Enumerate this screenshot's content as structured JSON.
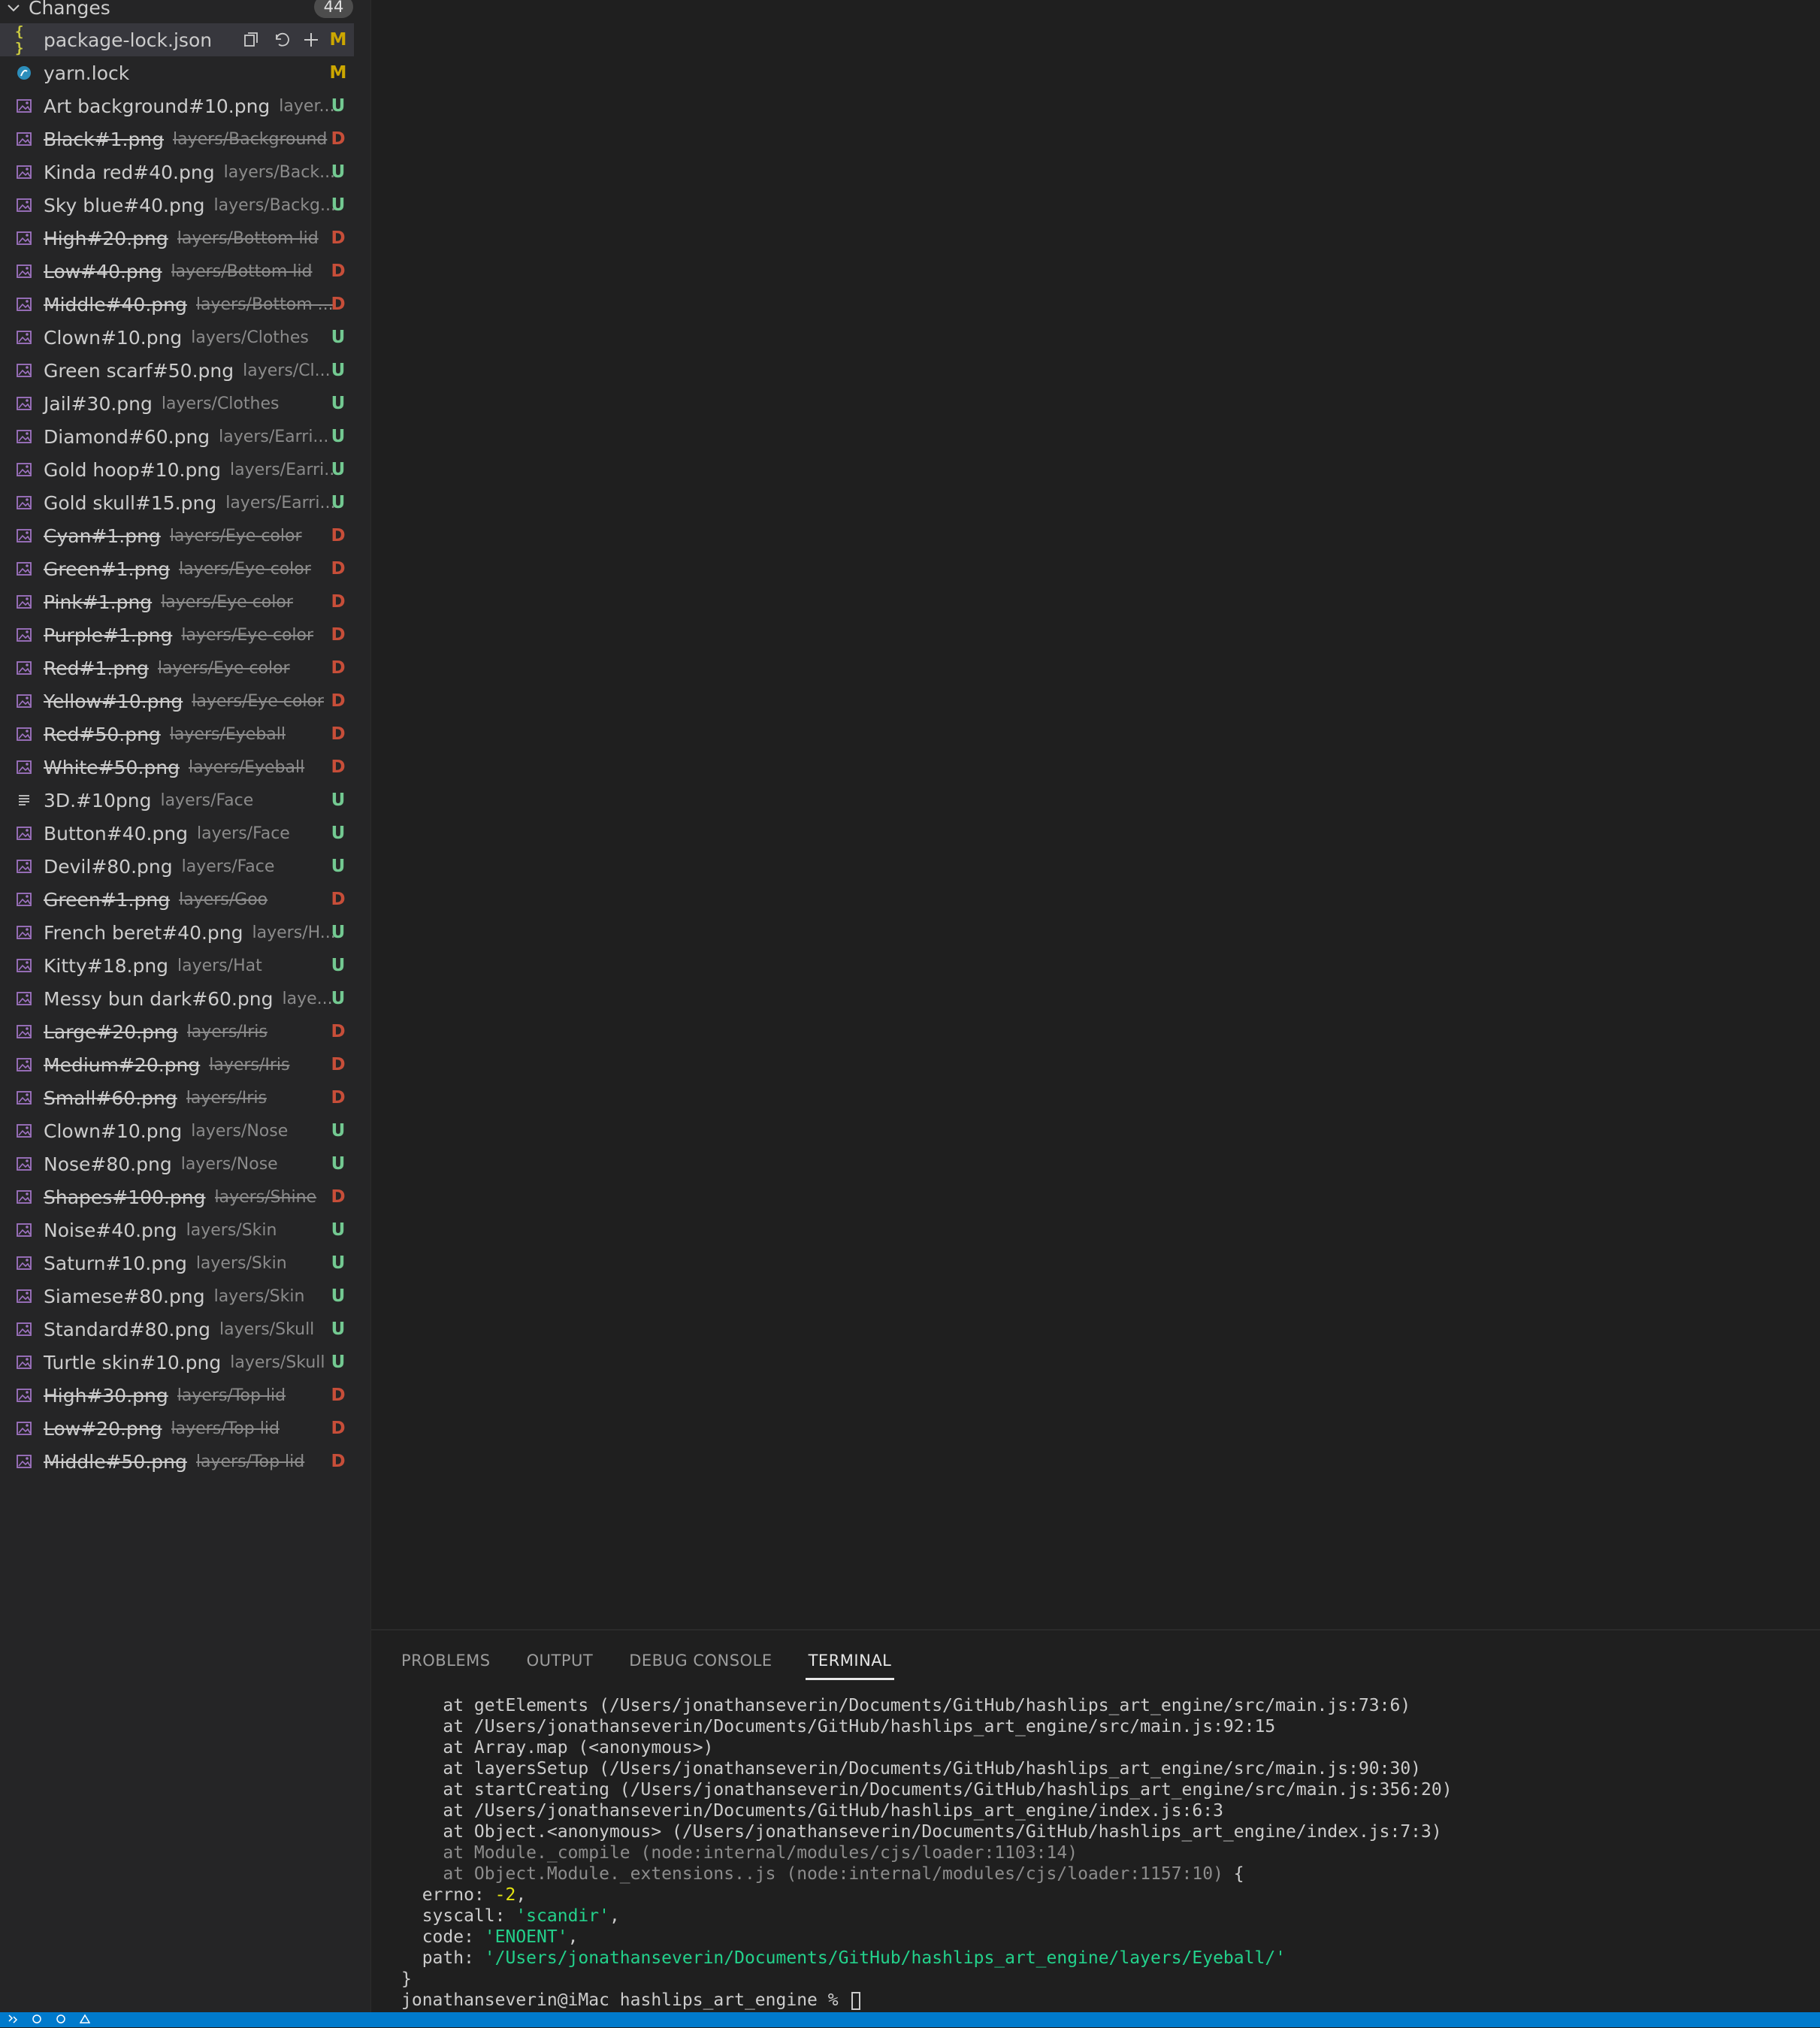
{
  "sidebar": {
    "section_title": "Changes",
    "count": "44",
    "files": [
      {
        "name": "package-lock.json",
        "path": "",
        "status": "M",
        "icon": "json-icon",
        "deleted": false,
        "selected": true
      },
      {
        "name": "yarn.lock",
        "path": "",
        "status": "M",
        "icon": "yarn-icon",
        "deleted": false
      },
      {
        "name": "Art background#10.png",
        "path": "layer...",
        "status": "U",
        "icon": "image-icon",
        "deleted": false
      },
      {
        "name": "Black#1.png",
        "path": "layers/Background",
        "status": "D",
        "icon": "image-icon",
        "deleted": true
      },
      {
        "name": "Kinda red#40.png",
        "path": "layers/Back...",
        "status": "U",
        "icon": "image-icon",
        "deleted": false
      },
      {
        "name": "Sky blue#40.png",
        "path": "layers/Backg...",
        "status": "U",
        "icon": "image-icon",
        "deleted": false
      },
      {
        "name": "High#20.png",
        "path": "layers/Bottom lid",
        "status": "D",
        "icon": "image-icon",
        "deleted": true
      },
      {
        "name": "Low#40.png",
        "path": "layers/Bottom lid",
        "status": "D",
        "icon": "image-icon",
        "deleted": true
      },
      {
        "name": "Middle#40.png",
        "path": "layers/Bottom ...",
        "status": "D",
        "icon": "image-icon",
        "deleted": true
      },
      {
        "name": "Clown#10.png",
        "path": "layers/Clothes",
        "status": "U",
        "icon": "image-icon",
        "deleted": false
      },
      {
        "name": "Green scarf#50.png",
        "path": "layers/Cl...",
        "status": "U",
        "icon": "image-icon",
        "deleted": false
      },
      {
        "name": "Jail#30.png",
        "path": "layers/Clothes",
        "status": "U",
        "icon": "image-icon",
        "deleted": false
      },
      {
        "name": "Diamond#60.png",
        "path": "layers/Earri...",
        "status": "U",
        "icon": "image-icon",
        "deleted": false
      },
      {
        "name": "Gold hoop#10.png",
        "path": "layers/Earri...",
        "status": "U",
        "icon": "image-icon",
        "deleted": false
      },
      {
        "name": "Gold skull#15.png",
        "path": "layers/Earri...",
        "status": "U",
        "icon": "image-icon",
        "deleted": false
      },
      {
        "name": "Cyan#1.png",
        "path": "layers/Eye color",
        "status": "D",
        "icon": "image-icon",
        "deleted": true
      },
      {
        "name": "Green#1.png",
        "path": "layers/Eye color",
        "status": "D",
        "icon": "image-icon",
        "deleted": true
      },
      {
        "name": "Pink#1.png",
        "path": "layers/Eye color",
        "status": "D",
        "icon": "image-icon",
        "deleted": true
      },
      {
        "name": "Purple#1.png",
        "path": "layers/Eye color",
        "status": "D",
        "icon": "image-icon",
        "deleted": true
      },
      {
        "name": "Red#1.png",
        "path": "layers/Eye color",
        "status": "D",
        "icon": "image-icon",
        "deleted": true
      },
      {
        "name": "Yellow#10.png",
        "path": "layers/Eye color",
        "status": "D",
        "icon": "image-icon",
        "deleted": true
      },
      {
        "name": "Red#50.png",
        "path": "layers/Eyeball",
        "status": "D",
        "icon": "image-icon",
        "deleted": true
      },
      {
        "name": "White#50.png",
        "path": "layers/Eyeball",
        "status": "D",
        "icon": "image-icon",
        "deleted": true
      },
      {
        "name": "3D.#10png",
        "path": "layers/Face",
        "status": "U",
        "icon": "text-file-icon",
        "deleted": false
      },
      {
        "name": "Button#40.png",
        "path": "layers/Face",
        "status": "U",
        "icon": "image-icon",
        "deleted": false
      },
      {
        "name": "Devil#80.png",
        "path": "layers/Face",
        "status": "U",
        "icon": "image-icon",
        "deleted": false
      },
      {
        "name": "Green#1.png",
        "path": "layers/Goo",
        "status": "D",
        "icon": "image-icon",
        "deleted": true
      },
      {
        "name": "French beret#40.png",
        "path": "layers/H...",
        "status": "U",
        "icon": "image-icon",
        "deleted": false
      },
      {
        "name": "Kitty#18.png",
        "path": "layers/Hat",
        "status": "U",
        "icon": "image-icon",
        "deleted": false
      },
      {
        "name": "Messy bun dark#60.png",
        "path": "laye...",
        "status": "U",
        "icon": "image-icon",
        "deleted": false
      },
      {
        "name": "Large#20.png",
        "path": "layers/Iris",
        "status": "D",
        "icon": "image-icon",
        "deleted": true
      },
      {
        "name": "Medium#20.png",
        "path": "layers/Iris",
        "status": "D",
        "icon": "image-icon",
        "deleted": true
      },
      {
        "name": "Small#60.png",
        "path": "layers/Iris",
        "status": "D",
        "icon": "image-icon",
        "deleted": true
      },
      {
        "name": "Clown#10.png",
        "path": "layers/Nose",
        "status": "U",
        "icon": "image-icon",
        "deleted": false
      },
      {
        "name": "Nose#80.png",
        "path": "layers/Nose",
        "status": "U",
        "icon": "image-icon",
        "deleted": false
      },
      {
        "name": "Shapes#100.png",
        "path": "layers/Shine",
        "status": "D",
        "icon": "image-icon",
        "deleted": true
      },
      {
        "name": "Noise#40.png",
        "path": "layers/Skin",
        "status": "U",
        "icon": "image-icon",
        "deleted": false
      },
      {
        "name": "Saturn#10.png",
        "path": "layers/Skin",
        "status": "U",
        "icon": "image-icon",
        "deleted": false
      },
      {
        "name": "Siamese#80.png",
        "path": "layers/Skin",
        "status": "U",
        "icon": "image-icon",
        "deleted": false
      },
      {
        "name": "Standard#80.png",
        "path": "layers/Skull",
        "status": "U",
        "icon": "image-icon",
        "deleted": false
      },
      {
        "name": "Turtle skin#10.png",
        "path": "layers/Skull",
        "status": "U",
        "icon": "image-icon",
        "deleted": false
      },
      {
        "name": "High#30.png",
        "path": "layers/Top lid",
        "status": "D",
        "icon": "image-icon",
        "deleted": true
      },
      {
        "name": "Low#20.png",
        "path": "layers/Top lid",
        "status": "D",
        "icon": "image-icon",
        "deleted": true
      },
      {
        "name": "Middle#50.png",
        "path": "layers/Top lid",
        "status": "D",
        "icon": "image-icon",
        "deleted": true
      }
    ],
    "row_action_icons": [
      "open-file-icon",
      "discard-changes-icon",
      "stage-changes-icon"
    ]
  },
  "panel": {
    "tabs": [
      {
        "label": "PROBLEMS",
        "active": false
      },
      {
        "label": "OUTPUT",
        "active": false
      },
      {
        "label": "DEBUG CONSOLE",
        "active": false
      },
      {
        "label": "TERMINAL",
        "active": true
      }
    ],
    "terminal": {
      "lines": [
        {
          "segments": [
            {
              "text": "    at getElements (/Users/jonathanseverin/Documents/GitHub/hashlips_art_engine/src/main.js:73:6)",
              "style": "normal"
            }
          ]
        },
        {
          "segments": [
            {
              "text": "    at /Users/jonathanseverin/Documents/GitHub/hashlips_art_engine/src/main.js:92:15",
              "style": "normal"
            }
          ]
        },
        {
          "segments": [
            {
              "text": "    at Array.map (<anonymous>)",
              "style": "normal"
            }
          ]
        },
        {
          "segments": [
            {
              "text": "    at layersSetup (/Users/jonathanseverin/Documents/GitHub/hashlips_art_engine/src/main.js:90:30)",
              "style": "normal"
            }
          ]
        },
        {
          "segments": [
            {
              "text": "    at startCreating (/Users/jonathanseverin/Documents/GitHub/hashlips_art_engine/src/main.js:356:20)",
              "style": "normal"
            }
          ]
        },
        {
          "segments": [
            {
              "text": "    at /Users/jonathanseverin/Documents/GitHub/hashlips_art_engine/index.js:6:3",
              "style": "normal"
            }
          ]
        },
        {
          "segments": [
            {
              "text": "    at Object.<anonymous> (/Users/jonathanseverin/Documents/GitHub/hashlips_art_engine/index.js:7:3)",
              "style": "normal"
            }
          ]
        },
        {
          "segments": [
            {
              "text": "    at Module._compile (node:internal/modules/cjs/loader:1103:14)",
              "style": "dim"
            }
          ]
        },
        {
          "segments": [
            {
              "text": "    at Object.Module._extensions..js (node:internal/modules/cjs/loader:1157:10)",
              "style": "dim"
            },
            {
              "text": " {",
              "style": "normal"
            }
          ]
        },
        {
          "segments": [
            {
              "text": "  errno: ",
              "style": "normal"
            },
            {
              "text": "-2",
              "style": "num"
            },
            {
              "text": ",",
              "style": "normal"
            }
          ]
        },
        {
          "segments": [
            {
              "text": "  syscall: ",
              "style": "normal"
            },
            {
              "text": "'scandir'",
              "style": "str"
            },
            {
              "text": ",",
              "style": "normal"
            }
          ]
        },
        {
          "segments": [
            {
              "text": "  code: ",
              "style": "normal"
            },
            {
              "text": "'ENOENT'",
              "style": "str"
            },
            {
              "text": ",",
              "style": "normal"
            }
          ]
        },
        {
          "segments": [
            {
              "text": "  path: ",
              "style": "normal"
            },
            {
              "text": "'/Users/jonathanseverin/Documents/GitHub/hashlips_art_engine/layers/Eyeball/'",
              "style": "str"
            }
          ]
        },
        {
          "segments": [
            {
              "text": "}",
              "style": "normal"
            }
          ]
        }
      ],
      "prompt": "jonathanseverin@iMac hashlips_art_engine % "
    }
  },
  "colors": {
    "modified": "#cca700",
    "untracked": "#73c991",
    "deleted": "#c74e39",
    "statusbar": "#007acc"
  }
}
